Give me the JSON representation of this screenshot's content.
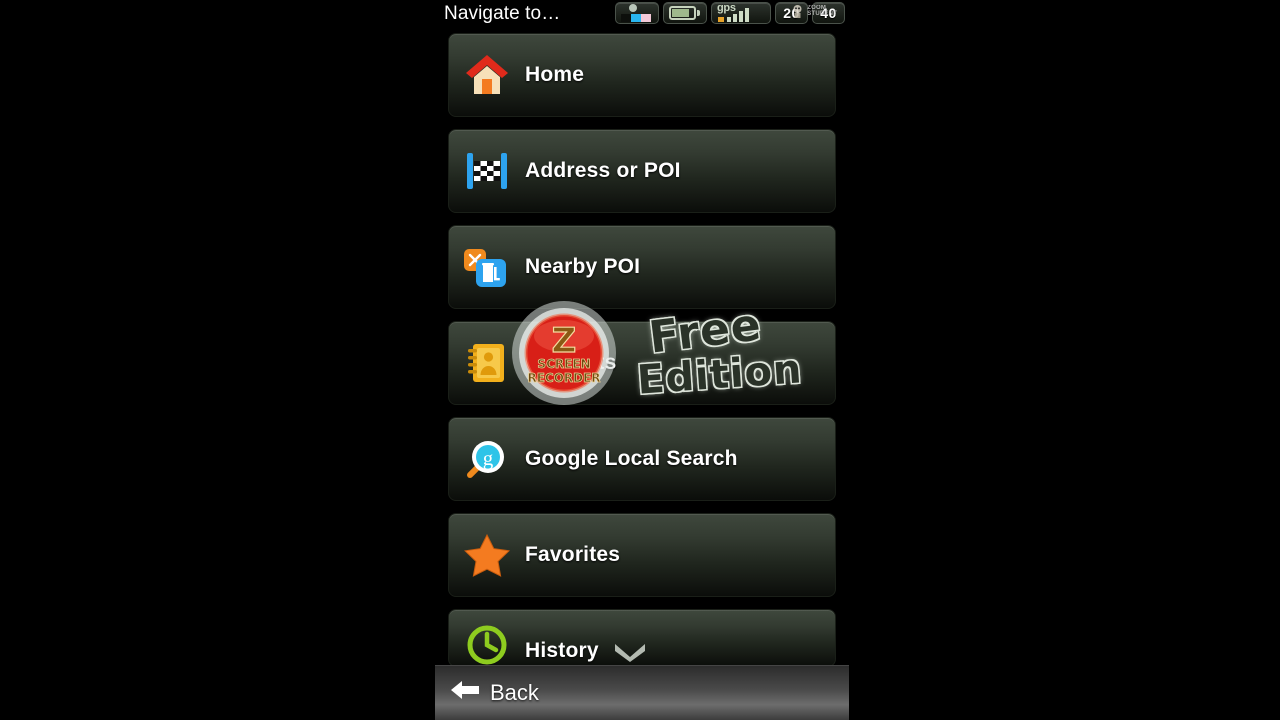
{
  "statusbar": {
    "title": "Navigate to…",
    "icons": [
      {
        "name": "signal-photo-icon"
      },
      {
        "name": "battery-icon"
      },
      {
        "name": "gps-signal-icon",
        "label": "gps"
      }
    ],
    "speed_limit": "20",
    "speed_current": "40"
  },
  "menu": {
    "items": [
      {
        "label": "Home",
        "icon": "home-icon"
      },
      {
        "label": "Address or POI",
        "icon": "checkered-flag-icon"
      },
      {
        "label": "Nearby POI",
        "icon": "gas-pump-icon"
      },
      {
        "label": "Contacts",
        "icon": "address-book-icon"
      },
      {
        "label": "Google Local Search",
        "icon": "magnifier-google-icon"
      },
      {
        "label": "Favorites",
        "icon": "star-icon"
      },
      {
        "label": "History",
        "icon": "clock-icon",
        "chevron": "chevron-down-icon"
      }
    ]
  },
  "bottombar": {
    "back_label": "Back",
    "back_icon": "arrow-left-icon"
  },
  "watermark": {
    "logo_letter": "Z",
    "logo_line1": "SCREEN",
    "logo_line2": "RECORDER",
    "word1": "Free",
    "word2": "Edition",
    "corner_line1": "ZOOM",
    "corner_line2": "STUDENT"
  },
  "colors": {
    "row_top": "#3f483d",
    "row_bottom": "#0b0d0a",
    "accent_orange": "#f47b20",
    "accent_blue": "#2da3ef",
    "accent_green": "#8ecc1f",
    "accent_red": "#e02a1b",
    "text": "#ffffff"
  }
}
